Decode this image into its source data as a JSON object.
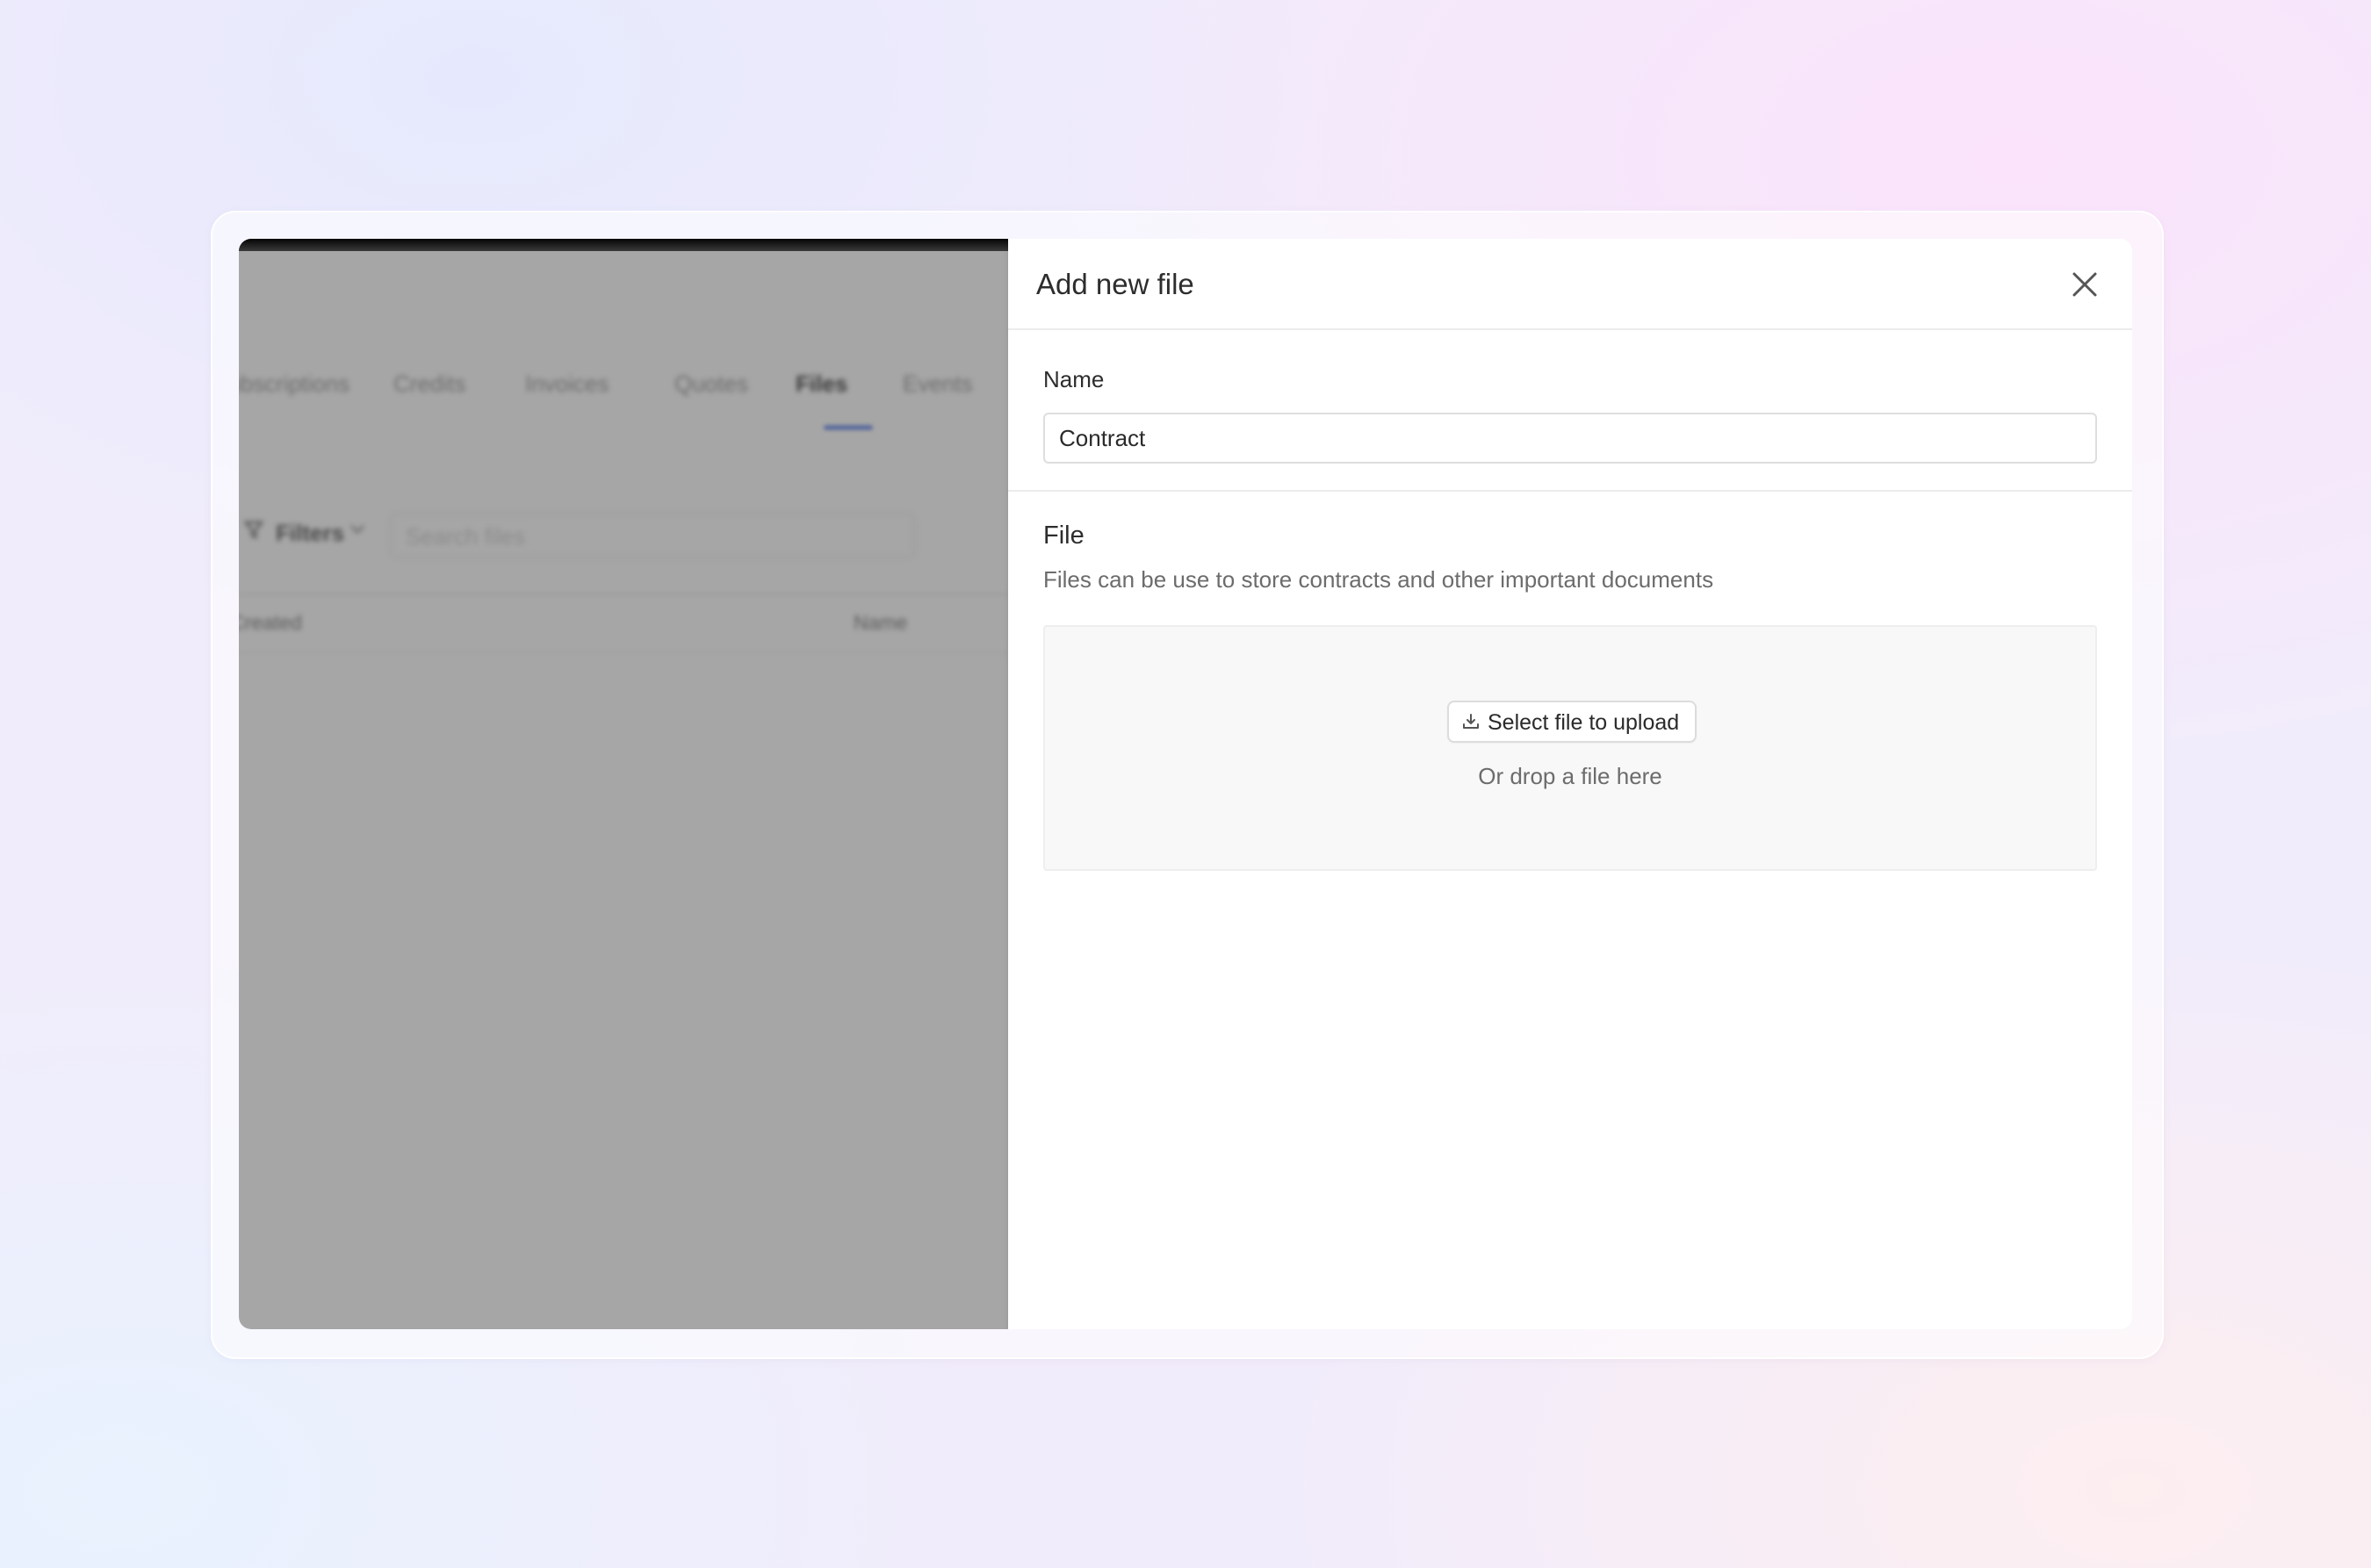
{
  "background_app": {
    "tabs": [
      {
        "label": "Subscriptions"
      },
      {
        "label": "Credits"
      },
      {
        "label": "Invoices"
      },
      {
        "label": "Quotes"
      },
      {
        "label": "Files",
        "active": true
      },
      {
        "label": "Events"
      }
    ],
    "filters_label": "Filters",
    "search_placeholder": "Search files",
    "columns": [
      "Created",
      "Name"
    ]
  },
  "drawer": {
    "title": "Add new file",
    "close_icon": "close-icon",
    "name_label": "Name",
    "name_value": "Contract",
    "file_title": "File",
    "file_description": "Files can be use to store contracts and other important documents",
    "upload_button_label": "Select file to upload",
    "upload_icon": "download-tray-icon",
    "drop_hint": "Or drop a file here"
  },
  "colors": {
    "overlay": "#a6a6a6",
    "active_tab_underline": "#5d6d9c",
    "dropzone_bg": "#f8f8f8"
  }
}
